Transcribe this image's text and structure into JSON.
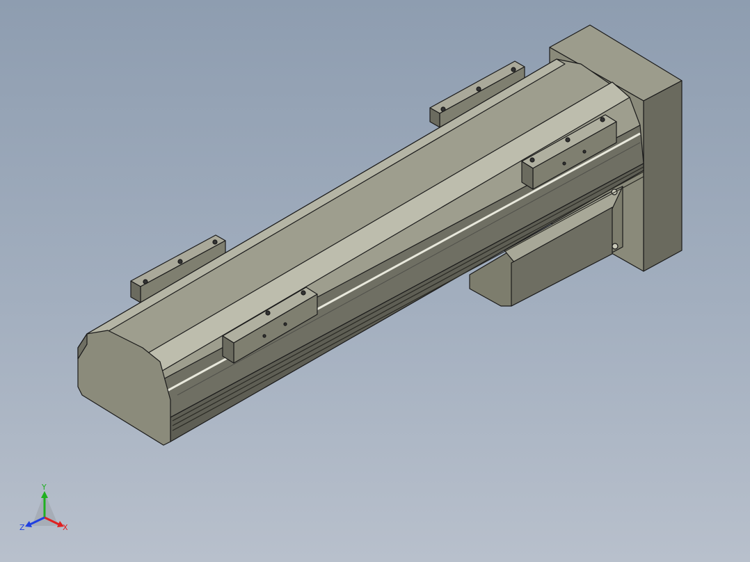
{
  "viewport": {
    "name": "3D model view",
    "model_color": "#7a7a6a"
  },
  "triad": {
    "x_label": "X",
    "y_label": "Y",
    "z_label": "Z",
    "x_color": "#e02020",
    "y_color": "#20b020",
    "z_color": "#2040e0"
  }
}
